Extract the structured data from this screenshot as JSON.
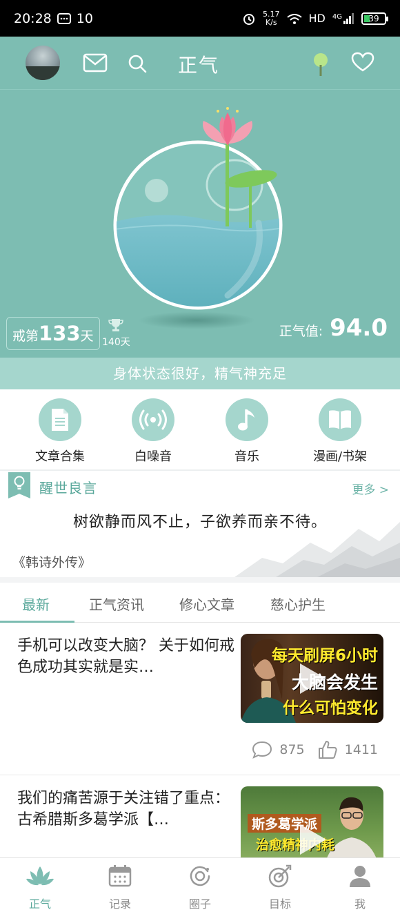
{
  "status_bar": {
    "time": "20:28",
    "notif_count": "10",
    "speed_value": "5.17",
    "speed_unit": "K/s",
    "network": "HD",
    "signal": "4G",
    "battery": "39"
  },
  "header": {
    "title": "正气",
    "icons": [
      "avatar",
      "mail-icon",
      "search-icon",
      "tree-icon",
      "heart-icon"
    ]
  },
  "hero": {
    "streak_prefix": "戒第",
    "streak_days": "133",
    "streak_suffix": "天",
    "best_record": "140天",
    "zhengqi_label": "正气值:",
    "zhengqi_value": "94.0",
    "status_message": "身体状态很好，精气神充足",
    "colors": {
      "bg": "#7dbdb2",
      "water": "#6bb8c5",
      "lotus": "#f38fa7",
      "leaf": "#7ec95b"
    }
  },
  "quick_actions": [
    {
      "label": "文章合集",
      "icon": "document-icon"
    },
    {
      "label": "白噪音",
      "icon": "radio-waves-icon"
    },
    {
      "label": "音乐",
      "icon": "music-note-icon"
    },
    {
      "label": "漫画/书架",
      "icon": "open-book-icon"
    }
  ],
  "quote_card": {
    "title": "醒世良言",
    "more": "更多 >",
    "text": "树欲静而风不止，子欲养而亲不待。",
    "source": "《韩诗外传》"
  },
  "tabs": [
    {
      "label": "最新",
      "active": true
    },
    {
      "label": "正气资讯",
      "active": false
    },
    {
      "label": "修心文章",
      "active": false
    },
    {
      "label": "慈心护生",
      "active": false
    }
  ],
  "articles": [
    {
      "title": "手机可以改变大脑？ 关于如何戒色成功其实就是实…",
      "thumb_lines": [
        "每天刷屏6小时",
        "大脑会发生",
        "什么可怕变化"
      ],
      "comments": "875",
      "likes": "1411"
    },
    {
      "title": "我们的痛苦源于关注错了重点：古希腊斯多葛学派【…",
      "thumb_lines": [
        "斯多葛学派",
        "治愈精神内耗"
      ]
    }
  ],
  "bottom_nav": [
    {
      "label": "正气",
      "icon": "lotus-icon",
      "active": true
    },
    {
      "label": "记录",
      "icon": "calendar-icon",
      "active": false
    },
    {
      "label": "圈子",
      "icon": "circle-icon",
      "active": false
    },
    {
      "label": "目标",
      "icon": "target-icon",
      "active": false
    },
    {
      "label": "我",
      "icon": "user-icon",
      "active": false
    }
  ]
}
